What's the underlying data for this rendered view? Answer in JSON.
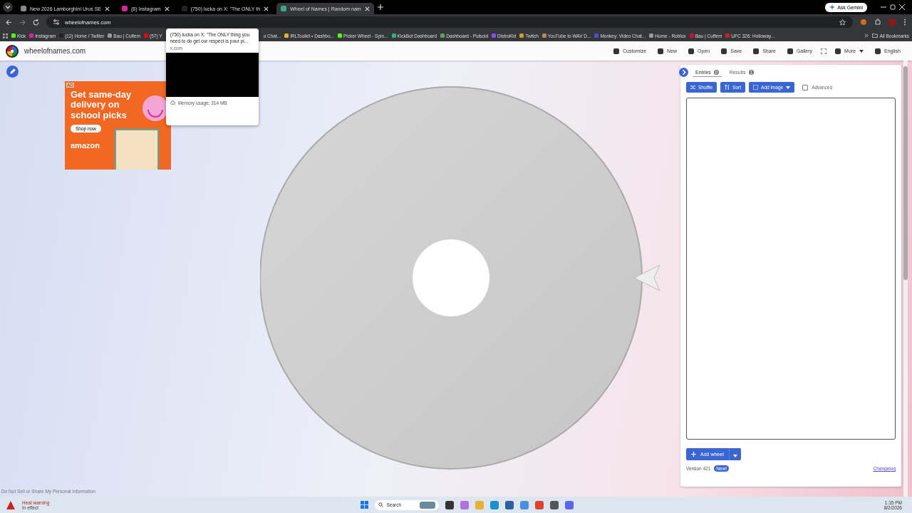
{
  "browser": {
    "tabs": [
      {
        "title": "New 2026 Lamborghini Urus SE",
        "selected": false
      },
      {
        "title": "(8) Instagram",
        "selected": false
      },
      {
        "title": "(750) lucka on X: \"The ONLY th",
        "selected": false
      },
      {
        "title": "Wheel of Names | Random nam",
        "selected": true
      }
    ],
    "ask_button": "Ask Gemini",
    "url": "wheelofnames.com",
    "bookmarks_left": [
      "Kick",
      "Instagram",
      "(12) Home / Twitter",
      "Bau | Cuffem",
      "(57) Y"
    ],
    "bookmarks_right": [
      "o Chat...",
      "IRLToolkit • Dashbo...",
      "Picker Wheel - Spin...",
      "KickBot Dashboard",
      "Dashboard - Pulsoid",
      "DistroKid",
      "Twitch",
      "YouTube to WAV D...",
      "Monkey: Video Chat...",
      "Home - Roblox",
      "Bau | Cuffem",
      "UFC 326: Holloway..."
    ],
    "all_bookmarks": "All Bookmarks",
    "tab_tooltip": {
      "title": "(750) lucka on X: \"The ONLY thing you need to do get our respect is pour pi...",
      "domain": "x.com",
      "memory": "Memory usage: 314 MB"
    }
  },
  "site": {
    "name": "wheelofnames.com",
    "toolbar": [
      "Customize",
      "New",
      "Open",
      "Save",
      "Share",
      "Gallery",
      "More",
      "English"
    ],
    "ad": {
      "label": "AD",
      "headline": "Get same-day delivery on school picks",
      "button": "Shop now",
      "brand": "amazon"
    },
    "panel": {
      "tabs": [
        {
          "label": "Entries",
          "count": "0",
          "selected": true
        },
        {
          "label": "Results",
          "count": "1",
          "selected": false
        }
      ],
      "buttons": [
        "Shuffle",
        "Sort",
        "Add image"
      ],
      "advanced": {
        "label": "Advanced",
        "checked": false
      },
      "add_wheel": "Add wheel",
      "version": "Version 421",
      "version_badge": "New!",
      "changelog": "Changelog"
    },
    "privacy_link": "Do Not Sell or Share My Personal Information"
  },
  "taskbar": {
    "weather": {
      "title": "Heat warning",
      "subtitle": "In effect"
    },
    "search": "Search",
    "time": "1:15 PM",
    "date": "8/2/2026"
  }
}
